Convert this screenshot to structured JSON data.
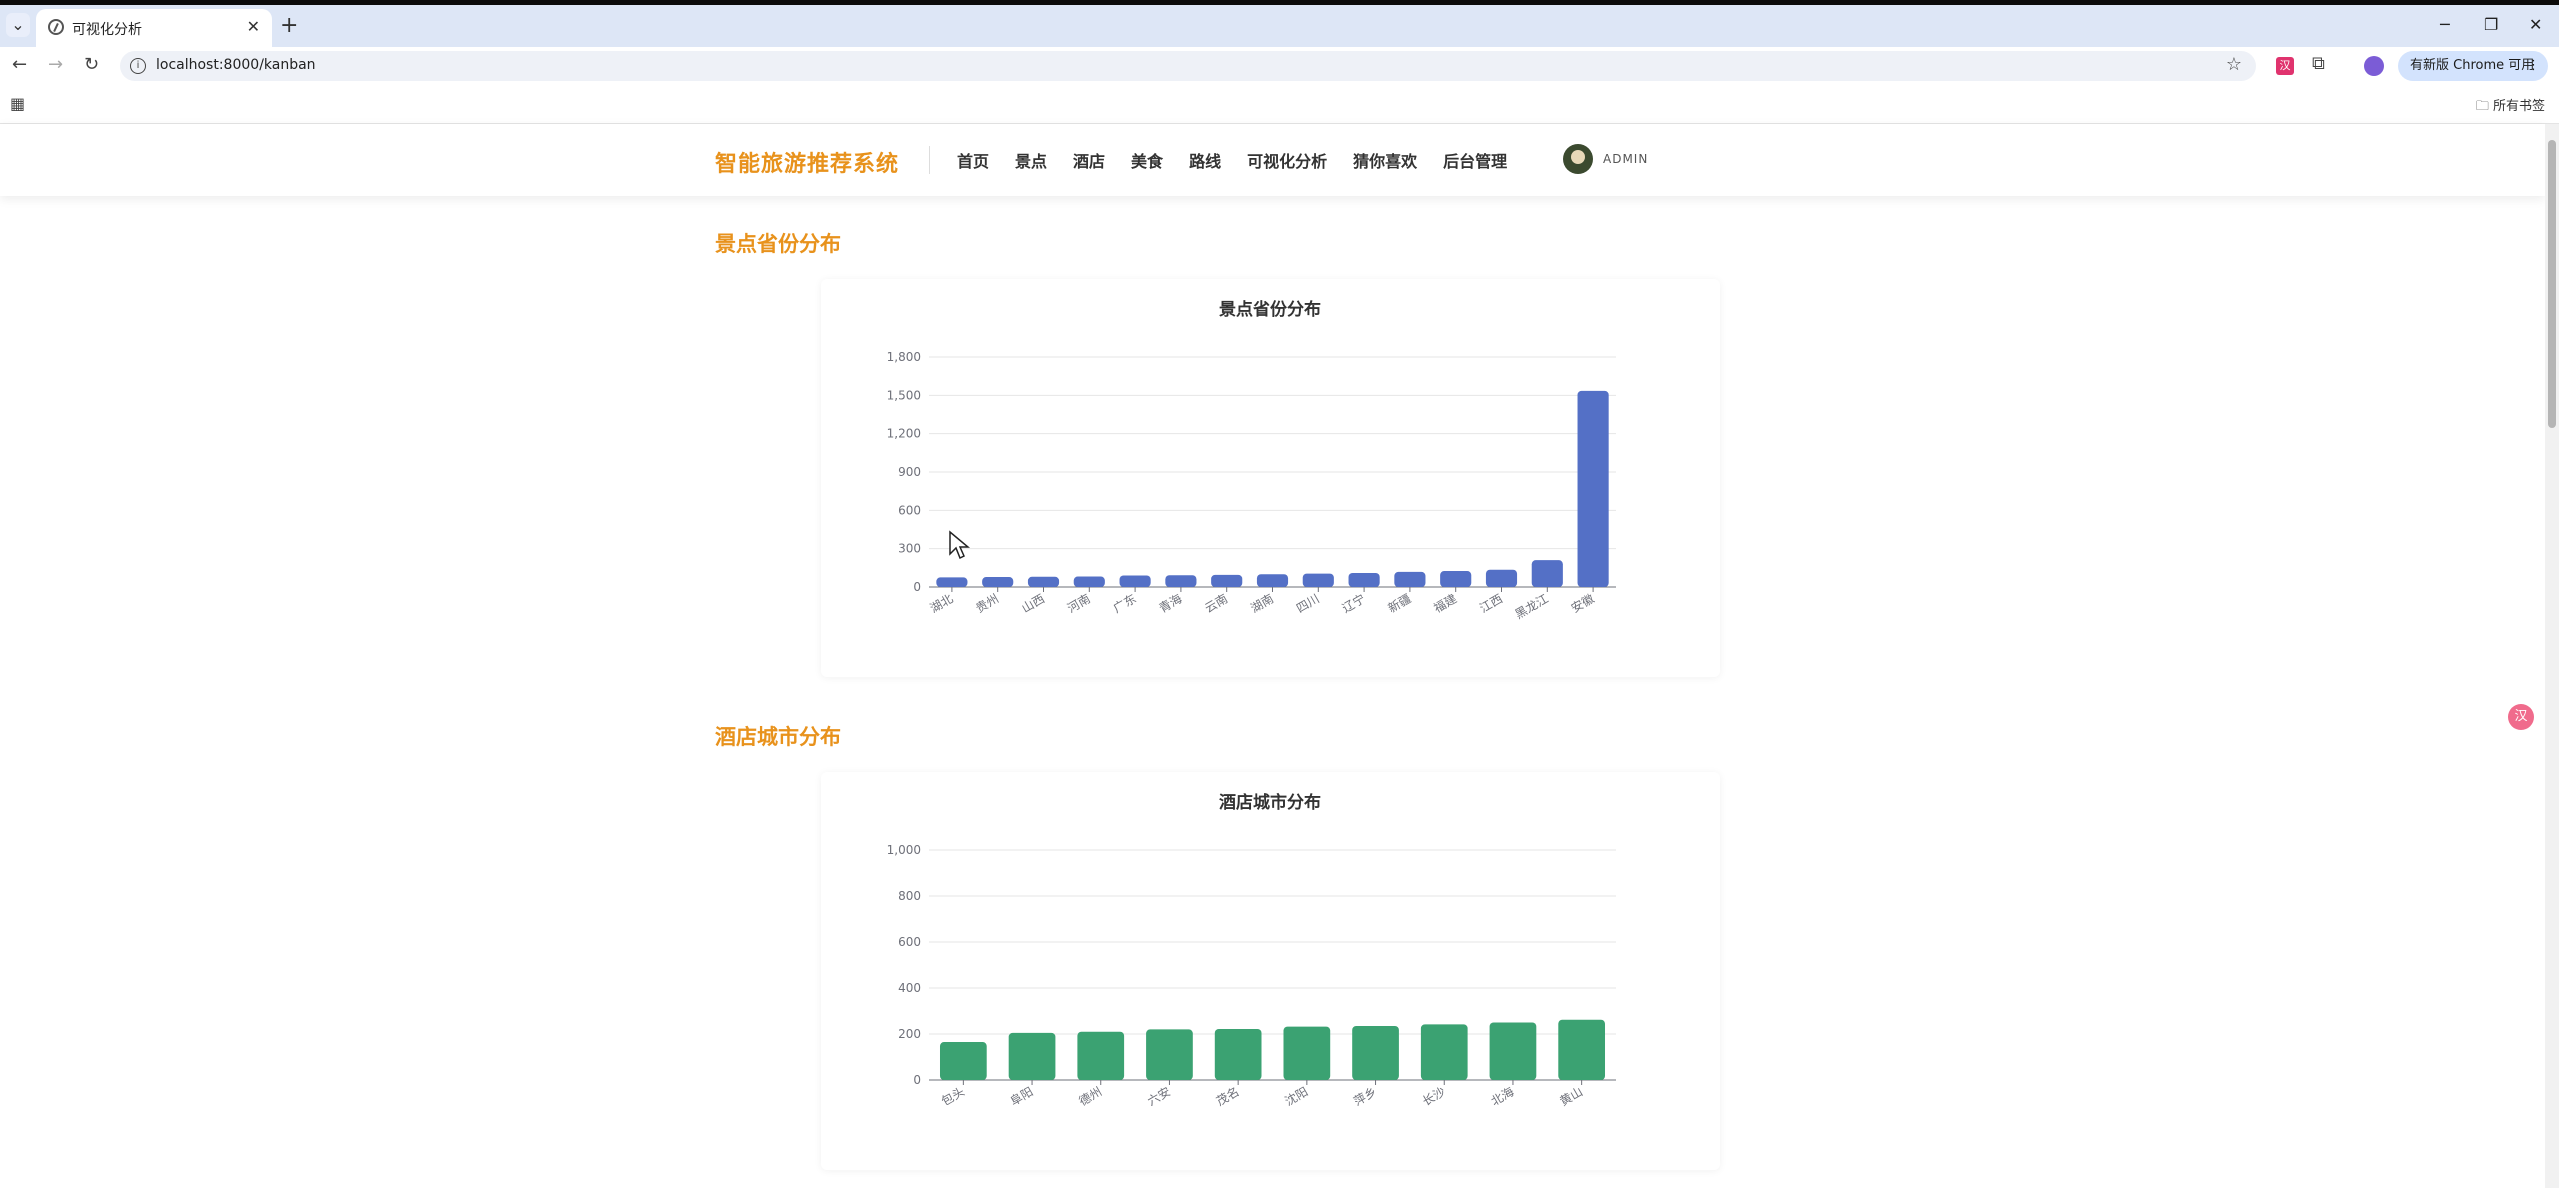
{
  "browser": {
    "tab_title": "可视化分析",
    "url": "localhost:8000/kanban",
    "update_chip": "有新版 Chrome 可用",
    "all_bookmarks": "所有书签",
    "ext_badge": "汉"
  },
  "header": {
    "brand": "智能旅游推荐系统",
    "nav": [
      "首页",
      "景点",
      "酒店",
      "美食",
      "路线",
      "可视化分析",
      "猜你喜欢",
      "后台管理"
    ],
    "user": "ADMIN"
  },
  "sections": [
    {
      "title": "景点省份分布"
    },
    {
      "title": "酒店城市分布"
    }
  ],
  "colors": {
    "brand": "#e8921c",
    "bar1": "#5470c6",
    "bar2": "#3ba272"
  },
  "chart_data": [
    {
      "type": "bar",
      "title": "景点省份分布",
      "categories": [
        "湖北",
        "贵州",
        "山西",
        "河南",
        "广东",
        "青海",
        "云南",
        "湖南",
        "四川",
        "辽宁",
        "新疆",
        "福建",
        "江西",
        "黑龙江",
        "安徽"
      ],
      "values": [
        75,
        78,
        80,
        82,
        90,
        92,
        95,
        100,
        105,
        110,
        118,
        125,
        135,
        210,
        1535
      ],
      "ylim": [
        0,
        1800
      ],
      "yticks": [
        0,
        300,
        600,
        900,
        1200,
        1500,
        1800
      ],
      "ytick_labels": [
        "0",
        "300",
        "600",
        "900",
        "1,200",
        "1,500",
        "1,800"
      ],
      "grid": true,
      "color": "#5470c6"
    },
    {
      "type": "bar",
      "title": "酒店城市分布",
      "categories": [
        "包头",
        "阜阳",
        "德州",
        "六安",
        "茂名",
        "沈阳",
        "萍乡",
        "长沙",
        "北海",
        "黄山"
      ],
      "values": [
        165,
        205,
        210,
        220,
        222,
        232,
        235,
        242,
        250,
        262
      ],
      "ylim": [
        0,
        1000
      ],
      "yticks": [
        0,
        200,
        400,
        600,
        800,
        1000
      ],
      "ytick_labels": [
        "0",
        "200",
        "400",
        "600",
        "800",
        "1,000"
      ],
      "grid": true,
      "color": "#3ba272"
    }
  ]
}
